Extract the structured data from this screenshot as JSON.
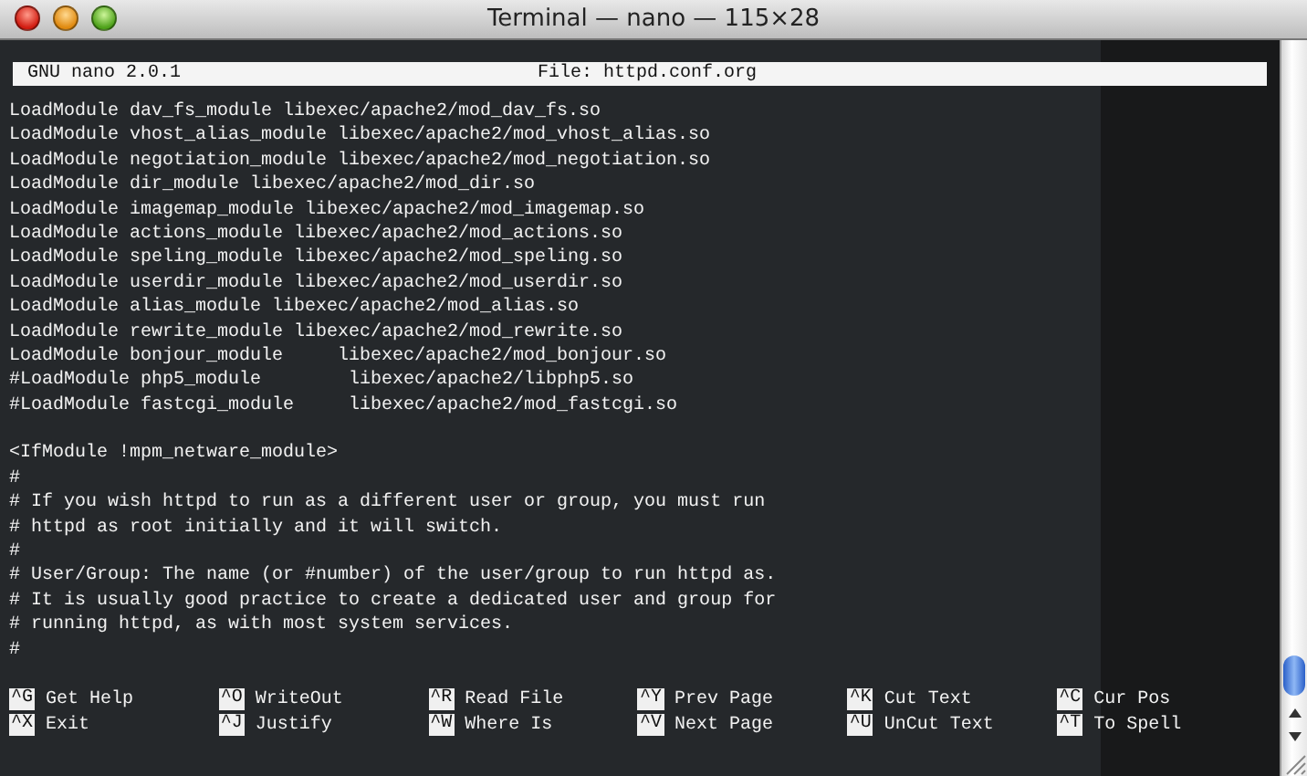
{
  "window": {
    "title": "Terminal — nano — 115×28"
  },
  "status_bar": {
    "program": "GNU nano 2.0.1",
    "file": "File: httpd.conf.org"
  },
  "blocks": [
    [
      "LoadModule dav_fs_module libexec/apache2/mod_dav_fs.so",
      "LoadModule vhost_alias_module libexec/apache2/mod_vhost_alias.so",
      "LoadModule negotiation_module libexec/apache2/mod_negotiation.so",
      "LoadModule dir_module libexec/apache2/mod_dir.so",
      "LoadModule imagemap_module libexec/apache2/mod_imagemap.so",
      "LoadModule actions_module libexec/apache2/mod_actions.so",
      "LoadModule speling_module libexec/apache2/mod_speling.so",
      "LoadModule userdir_module libexec/apache2/mod_userdir.so",
      "LoadModule alias_module libexec/apache2/mod_alias.so",
      "LoadModule rewrite_module libexec/apache2/mod_rewrite.so",
      "LoadModule bonjour_module     libexec/apache2/mod_bonjour.so",
      "#LoadModule php5_module        libexec/apache2/libphp5.so",
      "#LoadModule fastcgi_module     libexec/apache2/mod_fastcgi.so"
    ],
    [
      "<IfModule !mpm_netware_module>",
      "#",
      "# If you wish httpd to run as a different user or group, you must run",
      "# httpd as root initially and it will switch.",
      "#",
      "# User/Group: The name (or #number) of the user/group to run httpd as.",
      "# It is usually good practice to create a dedicated user and group for",
      "# running httpd, as with most system services.",
      "#"
    ]
  ],
  "shortcuts": [
    [
      {
        "key": "^G",
        "label": "Get Help"
      },
      {
        "key": "^O",
        "label": "WriteOut"
      },
      {
        "key": "^R",
        "label": "Read File"
      },
      {
        "key": "^Y",
        "label": "Prev Page"
      },
      {
        "key": "^K",
        "label": "Cut Text"
      },
      {
        "key": "^C",
        "label": "Cur Pos"
      }
    ],
    [
      {
        "key": "^X",
        "label": "Exit"
      },
      {
        "key": "^J",
        "label": "Justify"
      },
      {
        "key": "^W",
        "label": "Where Is"
      },
      {
        "key": "^V",
        "label": "Next Page"
      },
      {
        "key": "^U",
        "label": "UnCut Text"
      },
      {
        "key": "^T",
        "label": "To Spell"
      }
    ]
  ]
}
